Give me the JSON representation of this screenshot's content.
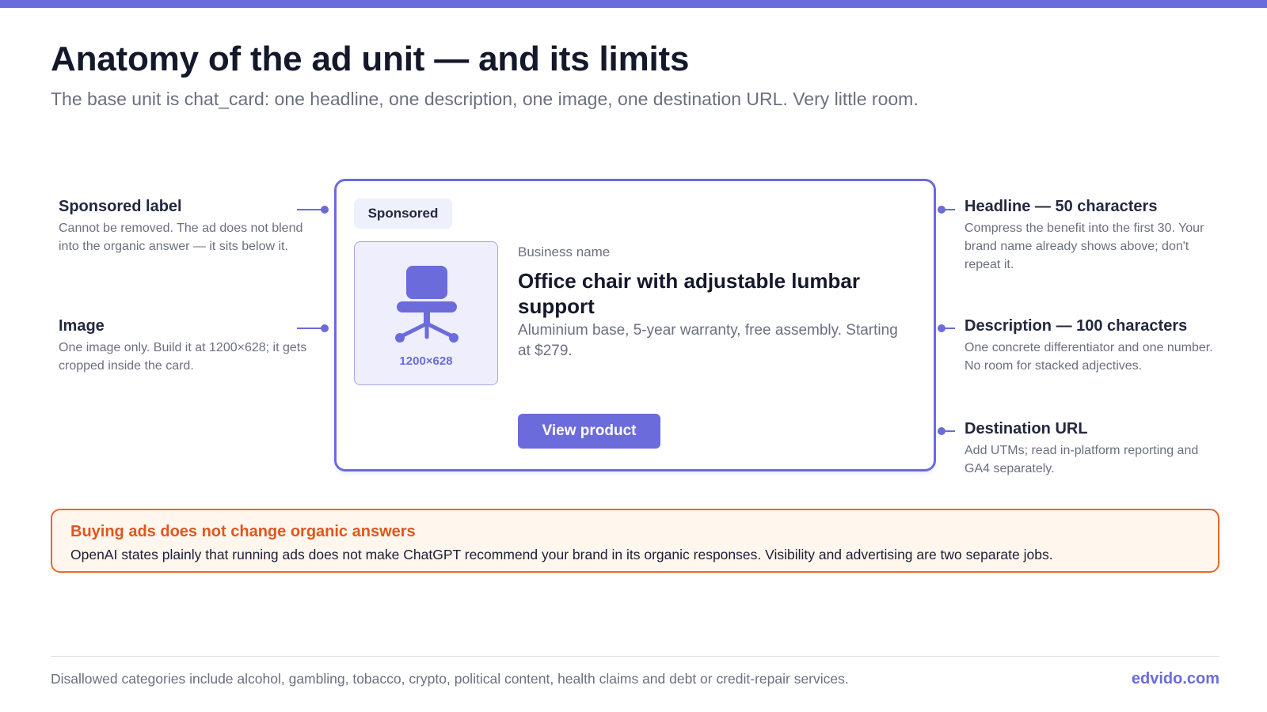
{
  "header": {
    "title": "Anatomy of the ad unit — and its limits",
    "subtitle": "The base unit is chat_card: one headline, one description, one image, one destination URL. Very little room."
  },
  "ad_card": {
    "sponsored_label": "Sponsored",
    "image_size": "1200×628",
    "image_icon": "office-chair-icon",
    "business_name": "Business name",
    "headline": "Office chair with adjustable lumbar support",
    "description": "Aluminium base, 5-year warranty, free assembly. Starting at $279.",
    "cta_label": "View product"
  },
  "annotations": {
    "left": [
      {
        "title": "Sponsored label",
        "body": "Cannot be removed. The ad does not blend into the organic answer — it sits below it."
      },
      {
        "title": "Image",
        "body": "One image only. Build it at 1200×628; it gets cropped inside the card."
      }
    ],
    "right": [
      {
        "title": "Headline — 50 characters",
        "body": "Compress the benefit into the first 30. Your brand name already shows above; don't repeat it."
      },
      {
        "title": "Description — 100 characters",
        "body": "One concrete differentiator and one number. No room for stacked adjectives."
      },
      {
        "title": "Destination URL",
        "body": "Add UTMs; read in-platform reporting and GA4 separately."
      }
    ]
  },
  "note": {
    "title": "Buying ads does not change organic answers",
    "body": "OpenAI states plainly that running ads does not make ChatGPT recommend your brand in its organic responses. Visibility and advertising are two separate jobs."
  },
  "footer": {
    "note": "Disallowed categories include alcohol, gambling, tobacco, crypto, political content, health claims and debt or credit-repair services.",
    "brand": "edvido.com"
  },
  "colors": {
    "accent": "#6b6bdc",
    "warning": "#e46a2c",
    "warning_bg": "#fff6ed"
  }
}
